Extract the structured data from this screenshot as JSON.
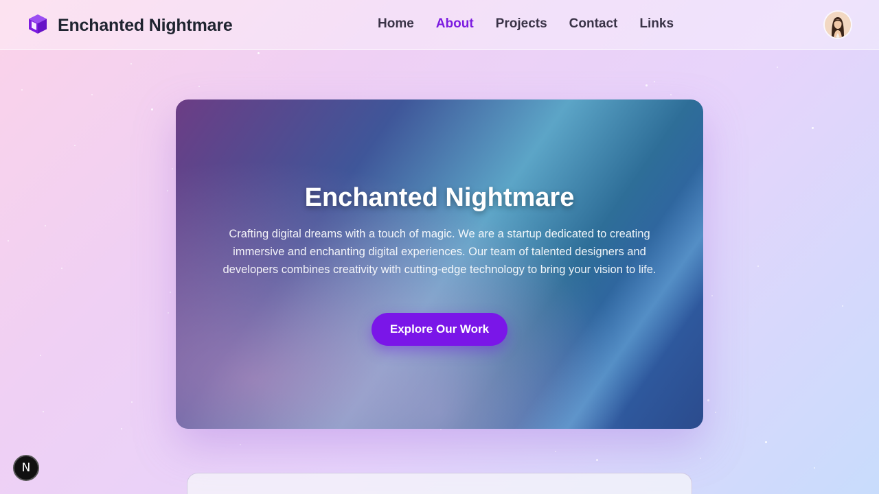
{
  "brand": {
    "name": "Enchanted Nightmare",
    "logo_icon": "cube-icon",
    "logo_color": "#7c1be0"
  },
  "nav": {
    "items": [
      {
        "label": "Home",
        "active": false
      },
      {
        "label": "About",
        "active": true
      },
      {
        "label": "Projects",
        "active": false
      },
      {
        "label": "Contact",
        "active": false
      },
      {
        "label": "Links",
        "active": false
      }
    ],
    "active_color": "#7c1be0"
  },
  "user": {
    "avatar_icon": "user-avatar"
  },
  "hero": {
    "title": "Enchanted Nightmare",
    "description": "Crafting digital dreams with a touch of magic. We are a startup dedicated to creating immersive and enchanting digital experiences. Our team of talented designers and developers combines creativity with cutting-edge technology to bring your vision to life.",
    "cta_label": "Explore Our Work",
    "cta_color": "#7a16e8"
  },
  "dev_badge": {
    "label": "N",
    "icon": "nextjs-icon"
  }
}
